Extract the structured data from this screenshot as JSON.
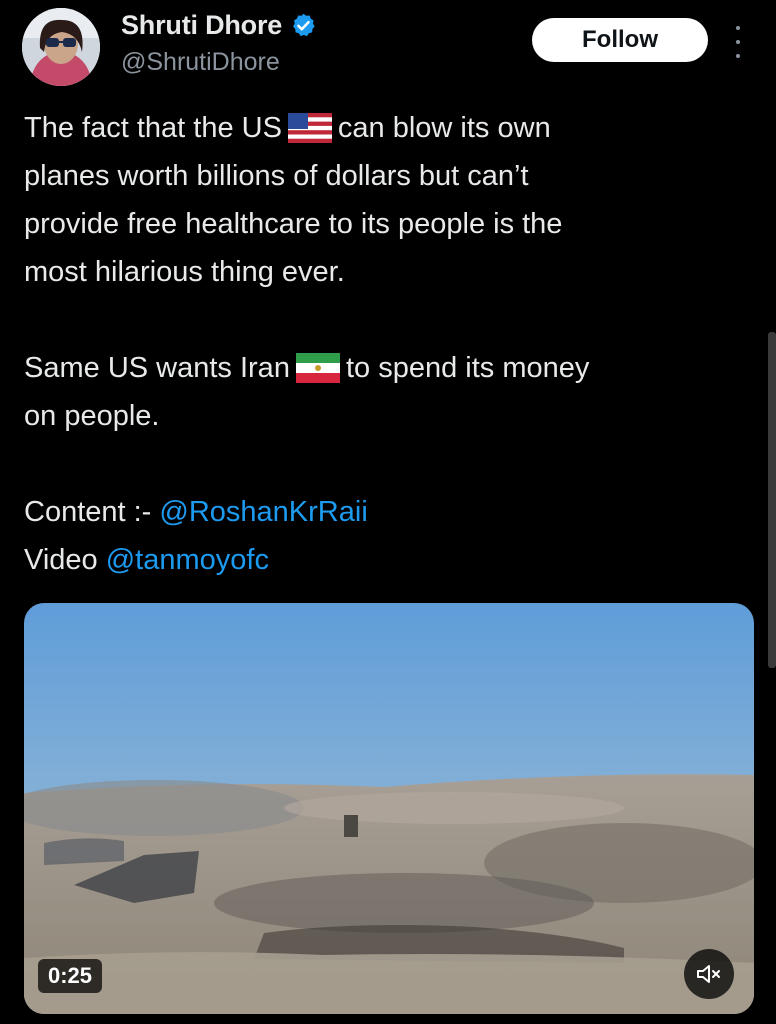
{
  "author": {
    "name": "Shruti Dhore",
    "handle": "@ShrutiDhore",
    "verified_icon": "verified-badge-icon",
    "avatar_icon": "avatar"
  },
  "actions": {
    "follow_label": "Follow",
    "more_icon": "more-options-icon"
  },
  "tweet": {
    "line1_a": "The fact that the US",
    "flag1": "us-flag-icon",
    "line1_b": "can blow its own",
    "line2": "planes worth billions of dollars but can’t",
    "line3": "provide free healthcare to its people is the",
    "line4": "most hilarious thing ever.",
    "line5_a": "Same US wants Iran",
    "flag2": "iran-flag-icon",
    "line5_b": "to spend its money",
    "line6": "on people.",
    "content_label": "Content :- ",
    "content_mention": "@RoshanKrRaii",
    "video_label": "Video ",
    "video_mention": "@tanmoyofc"
  },
  "media": {
    "duration": "0:25",
    "mute_icon": "volume-muted-icon"
  },
  "colors": {
    "background": "#000000",
    "text": "#e7e9ea",
    "secondary": "#8b949e",
    "link": "#1d9bf0",
    "verified": "#1d9bf0"
  }
}
